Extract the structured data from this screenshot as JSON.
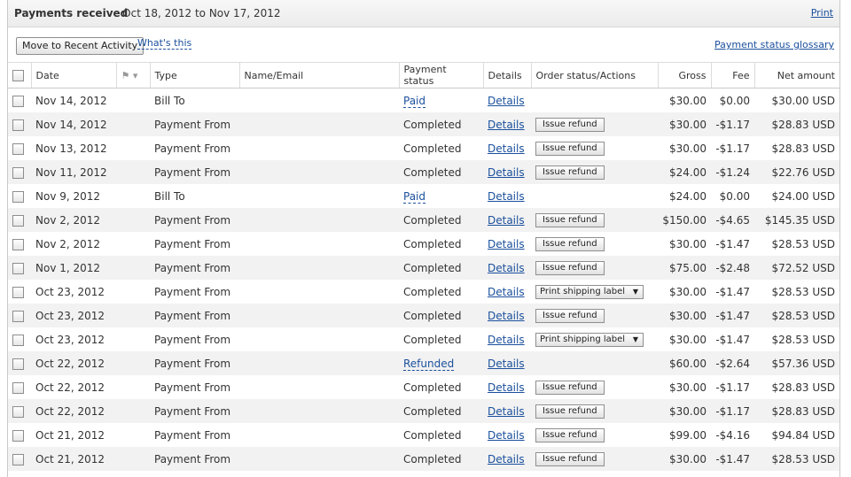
{
  "header": {
    "title": "Payments received",
    "date_range": "- Oct 18, 2012 to Nov 17, 2012",
    "print_label": "Print"
  },
  "toolbar": {
    "move_button": "Move to Recent Activity",
    "whats_this": "What's this",
    "glossary_link": "Payment status glossary"
  },
  "columns": {
    "date": "Date",
    "type": "Type",
    "name_email": "Name/Email",
    "payment_status": "Payment status",
    "details": "Details",
    "order_status": "Order status/Actions",
    "gross": "Gross",
    "fee": "Fee",
    "net": "Net amount"
  },
  "rows": [
    {
      "date": "Nov 14, 2012",
      "type": "Bill To",
      "name": "",
      "status": "Paid",
      "status_link": true,
      "details": "Details",
      "action_kind": "none",
      "action": "",
      "gross": "$30.00",
      "fee": "$0.00",
      "net": "$30.00 USD"
    },
    {
      "date": "Nov 14, 2012",
      "type": "Payment From",
      "name": "",
      "status": "Completed",
      "status_link": false,
      "details": "Details",
      "action_kind": "button",
      "action": "Issue refund",
      "gross": "$30.00",
      "fee": "-$1.17",
      "net": "$28.83 USD"
    },
    {
      "date": "Nov 13, 2012",
      "type": "Payment From",
      "name": "",
      "status": "Completed",
      "status_link": false,
      "details": "Details",
      "action_kind": "button",
      "action": "Issue refund",
      "gross": "$30.00",
      "fee": "-$1.17",
      "net": "$28.83 USD"
    },
    {
      "date": "Nov 11, 2012",
      "type": "Payment From",
      "name": "",
      "status": "Completed",
      "status_link": false,
      "details": "Details",
      "action_kind": "button",
      "action": "Issue refund",
      "gross": "$24.00",
      "fee": "-$1.24",
      "net": "$22.76 USD"
    },
    {
      "date": "Nov 9, 2012",
      "type": "Bill To",
      "name": "",
      "status": "Paid",
      "status_link": true,
      "details": "Details",
      "action_kind": "none",
      "action": "",
      "gross": "$24.00",
      "fee": "$0.00",
      "net": "$24.00 USD"
    },
    {
      "date": "Nov 2, 2012",
      "type": "Payment From",
      "name": "",
      "status": "Completed",
      "status_link": false,
      "details": "Details",
      "action_kind": "button",
      "action": "Issue refund",
      "gross": "$150.00",
      "fee": "-$4.65",
      "net": "$145.35 USD"
    },
    {
      "date": "Nov 2, 2012",
      "type": "Payment From",
      "name": "",
      "status": "Completed",
      "status_link": false,
      "details": "Details",
      "action_kind": "button",
      "action": "Issue refund",
      "gross": "$30.00",
      "fee": "-$1.47",
      "net": "$28.53 USD"
    },
    {
      "date": "Nov 1, 2012",
      "type": "Payment From",
      "name": "",
      "status": "Completed",
      "status_link": false,
      "details": "Details",
      "action_kind": "button",
      "action": "Issue refund",
      "gross": "$75.00",
      "fee": "-$2.48",
      "net": "$72.52 USD"
    },
    {
      "date": "Oct 23, 2012",
      "type": "Payment From",
      "name": "",
      "status": "Completed",
      "status_link": false,
      "details": "Details",
      "action_kind": "select",
      "action": "Print shipping label",
      "gross": "$30.00",
      "fee": "-$1.47",
      "net": "$28.53 USD"
    },
    {
      "date": "Oct 23, 2012",
      "type": "Payment From",
      "name": "",
      "status": "Completed",
      "status_link": false,
      "details": "Details",
      "action_kind": "button",
      "action": "Issue refund",
      "gross": "$30.00",
      "fee": "-$1.47",
      "net": "$28.53 USD"
    },
    {
      "date": "Oct 23, 2012",
      "type": "Payment From",
      "name": "",
      "status": "Completed",
      "status_link": false,
      "details": "Details",
      "action_kind": "select",
      "action": "Print shipping label",
      "gross": "$30.00",
      "fee": "-$1.47",
      "net": "$28.53 USD"
    },
    {
      "date": "Oct 22, 2012",
      "type": "Payment From",
      "name": "",
      "status": "Refunded",
      "status_link": true,
      "details": "Details",
      "action_kind": "none",
      "action": "",
      "gross": "$60.00",
      "fee": "-$2.64",
      "net": "$57.36 USD"
    },
    {
      "date": "Oct 22, 2012",
      "type": "Payment From",
      "name": "",
      "status": "Completed",
      "status_link": false,
      "details": "Details",
      "action_kind": "button",
      "action": "Issue refund",
      "gross": "$30.00",
      "fee": "-$1.17",
      "net": "$28.83 USD"
    },
    {
      "date": "Oct 22, 2012",
      "type": "Payment From",
      "name": "",
      "status": "Completed",
      "status_link": false,
      "details": "Details",
      "action_kind": "button",
      "action": "Issue refund",
      "gross": "$30.00",
      "fee": "-$1.17",
      "net": "$28.83 USD"
    },
    {
      "date": "Oct 21, 2012",
      "type": "Payment From",
      "name": "",
      "status": "Completed",
      "status_link": false,
      "details": "Details",
      "action_kind": "button",
      "action": "Issue refund",
      "gross": "$99.00",
      "fee": "-$4.16",
      "net": "$94.84 USD"
    },
    {
      "date": "Oct 21, 2012",
      "type": "Payment From",
      "name": "",
      "status": "Completed",
      "status_link": false,
      "details": "Details",
      "action_kind": "button",
      "action": "Issue refund",
      "gross": "$30.00",
      "fee": "-$1.47",
      "net": "$28.53 USD"
    }
  ]
}
